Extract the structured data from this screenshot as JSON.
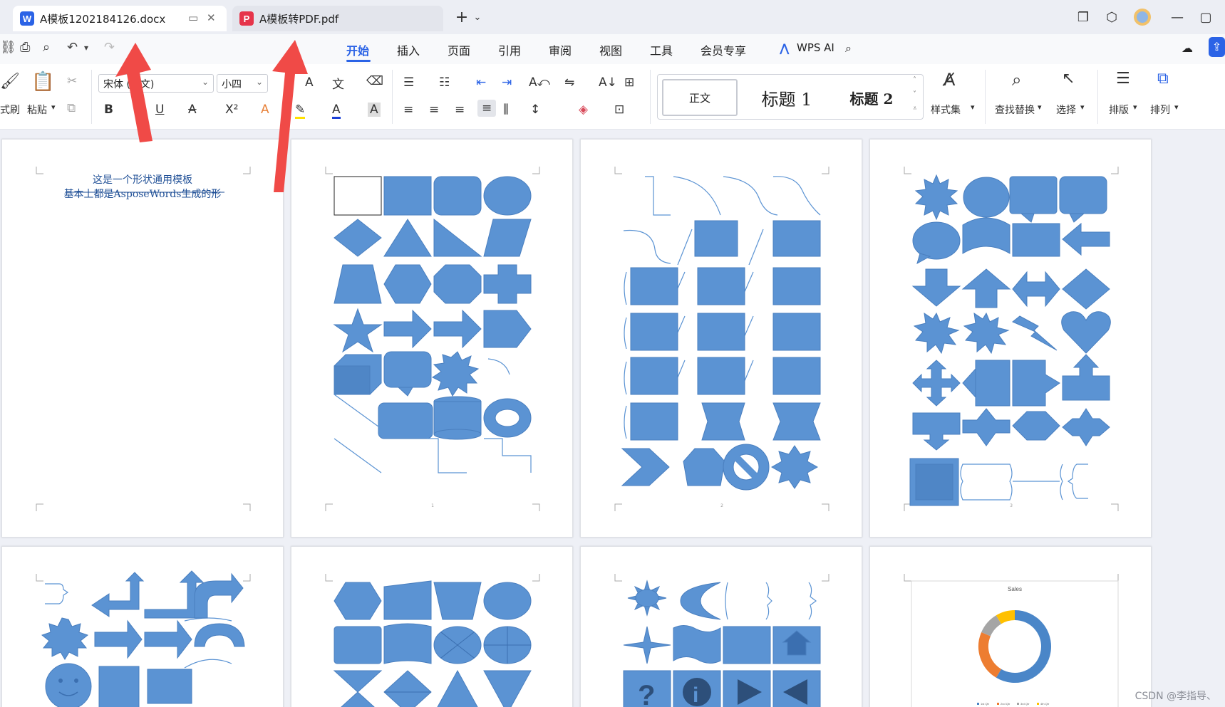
{
  "tabs": [
    {
      "badge": "W",
      "title": "A模板1202184126.docx",
      "badge_color": "#2b63e6",
      "active": true
    },
    {
      "badge": "P",
      "title": "A模板转PDF.pdf",
      "badge_color": "#e6344a",
      "active": false
    }
  ],
  "titlebar": {
    "new_tab": "+",
    "new_tab_menu": "⌄",
    "window_icons": [
      "restore-icon",
      "cube-icon",
      "avatar",
      "minimize-icon",
      "maximize-icon"
    ]
  },
  "menu": {
    "tabs": [
      "开始",
      "插入",
      "页面",
      "引用",
      "审阅",
      "视图",
      "工具",
      "会员专享"
    ],
    "active_index": 0,
    "wps_ai": "WPS AI"
  },
  "ribbon": {
    "format_painter": "式刷",
    "paste": "粘贴",
    "font_name": "宋体 (正文)",
    "font_size": "小四",
    "bold": "B",
    "underline": "U",
    "superscript": "X²",
    "styles": {
      "normal": "正文",
      "h1": "标题 1",
      "h2": "标题 2"
    },
    "style_set": "样式集",
    "find_replace": "查找替换",
    "select": "选择",
    "layout": "排版",
    "arrange": "排列"
  },
  "page1": {
    "line1": "这是一个形状通用模板",
    "line2": "基本上都是AsposeWords生成的形"
  },
  "chart_page": {
    "title": "Sales",
    "legend": [
      "1st Qtr",
      "2nd Qtr",
      "3rd Qtr",
      "4th Qtr"
    ],
    "values": [
      8.2,
      3.2,
      1.4,
      1.2
    ],
    "colors": [
      "#4a86c8",
      "#ed7d31",
      "#a5a5a5",
      "#ffc000"
    ]
  },
  "watermark": "CSDN @李指导、",
  "colors": {
    "accent": "#2b63e6",
    "shape_fill": "#5b93d3",
    "shape_stroke": "#4a7fbf",
    "arrow_red": "#f04a47"
  }
}
